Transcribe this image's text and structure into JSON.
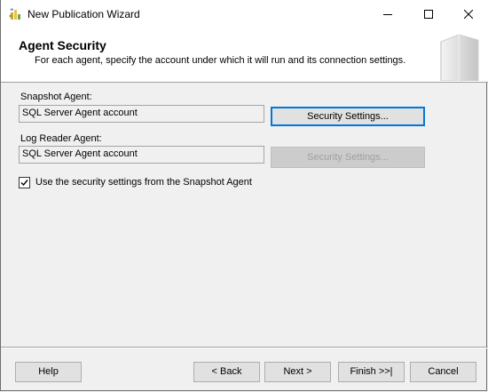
{
  "window": {
    "title": "New Publication Wizard",
    "icon": "wizard-icon",
    "controls": {
      "minimize": "minimize-icon",
      "maximize": "maximize-icon",
      "close": "close-icon"
    }
  },
  "header": {
    "title": "Agent Security",
    "subtitle": "For each agent, specify the account under which it will run and its connection settings.",
    "graphic": "server-graphic"
  },
  "snapshot_agent": {
    "label": "Snapshot Agent:",
    "account": "SQL Server Agent account",
    "button": "Security Settings..."
  },
  "log_reader_agent": {
    "label": "Log Reader Agent:",
    "account": "SQL Server Agent account",
    "button": "Security Settings..."
  },
  "use_snapshot_settings": {
    "label": "Use the security settings from the Snapshot Agent",
    "checked": true
  },
  "footer": {
    "help": "Help",
    "back": "< Back",
    "next": "Next >",
    "finish": "Finish >>|",
    "cancel": "Cancel"
  },
  "colors": {
    "focus_border": "#0078d7",
    "dialog_background": "#f0f0f0",
    "header_background": "#ffffff"
  }
}
